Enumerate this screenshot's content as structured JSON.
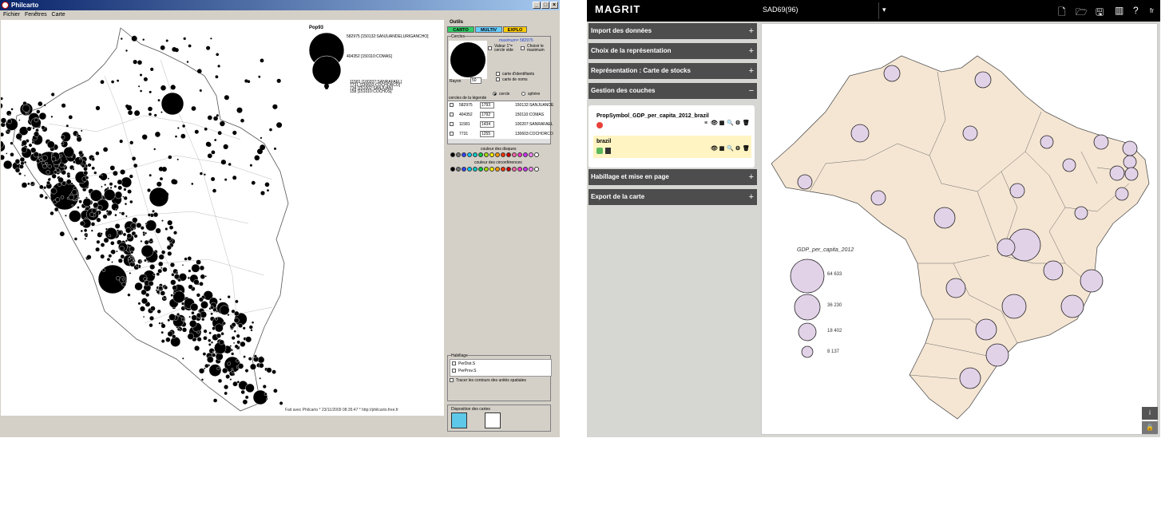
{
  "philcarto": {
    "title": "Philcarto",
    "menu": [
      "Fichier",
      "Fenêtres",
      "Carte"
    ],
    "window_buttons": [
      "_",
      "□",
      "×"
    ],
    "legend": {
      "title": "Pop93",
      "items": [
        {
          "value": "582975",
          "id": "[150132:SANJUANDELURIGANCHO]"
        },
        {
          "value": "404352",
          "id": "[150110:COMAS]"
        },
        {
          "value": "11581",
          "id": "[100207:SANRAFAEL]"
        },
        {
          "value": "7731",
          "id": "[130603:COCHORCO]"
        },
        {
          "value": "734",
          "id": "[151002:SANJUAN]"
        },
        {
          "value": "158",
          "id": "[151010:COCHOS]"
        }
      ]
    },
    "credit": "Fait avec Philcarto * 23/11/2009 08:35:47 * http://philcarto.free.fr",
    "tools": {
      "title": "Outils",
      "tabs": [
        {
          "label": "CARTO",
          "color": "#33cc66"
        },
        {
          "label": "MULTIV",
          "color": "#66ccff"
        },
        {
          "label": "EXPLO",
          "color": "#ffcc00"
        }
      ],
      "circles_group": "Cercles",
      "maximum": "maximum= 582975",
      "valeur_label": "Valeur 1\"= cercle vide",
      "choisir_label": "Choisir le maximum",
      "rayon_label": "Rayon",
      "rayon_value": "50",
      "carte_identifiants": "carte d'identifiants",
      "carte_noms": "carte de noms",
      "shape_options": [
        "cercle",
        "sphère"
      ],
      "legend_circles_title": "cercles de la légende",
      "legend_rows": [
        {
          "value": "582975",
          "pos": "1793",
          "name": "150132:SANJUANDE"
        },
        {
          "value": "404352",
          "pos": "1792",
          "name": "150110:COMAS"
        },
        {
          "value": "11581",
          "pos": "1434",
          "name": "100207:SANRAFAEL"
        },
        {
          "value": "7731",
          "pos": "1255",
          "name": "130603:COCHORCO"
        }
      ],
      "disc_color_label": "couleur des disques",
      "circ_color_label": "couleur des circonférences",
      "swatches": [
        "#000000",
        "#777777",
        "#3344ff",
        "#00ccff",
        "#00cccc",
        "#00cc44",
        "#aadd00",
        "#ffee00",
        "#ff9900",
        "#ff3300",
        "#cc0000",
        "#ff66aa",
        "#ff33cc",
        "#cc33ff",
        "#ff88ff",
        "#ffffff"
      ],
      "habillage_title": "Habillage",
      "habillage_items": [
        "PerDist.S",
        "PerProv.S"
      ],
      "trace_label": "Tracer les contours des unités spatiales",
      "disposition_title": "Disposition des cartes"
    }
  },
  "magrit": {
    "logo": "MAGRIT",
    "project": "SAD69(96)",
    "lang": "fr",
    "sections": [
      {
        "label": "Import des données",
        "sign": "+"
      },
      {
        "label": "Choix de la représentation",
        "sign": "+"
      },
      {
        "label": "Représentation : Carte de stocks",
        "sign": "+"
      },
      {
        "label": "Gestion des couches",
        "sign": "−"
      },
      {
        "label": "Habillage et mise en page",
        "sign": "+"
      },
      {
        "label": "Export de la carte",
        "sign": "+"
      }
    ],
    "layers": [
      {
        "name": "PropSymbol_GDP_per_capita_2012_brazil"
      },
      {
        "name": "brazil"
      }
    ],
    "map_legend": {
      "title": "GDP_per_capita_2012",
      "items": [
        "64 633",
        "36 230",
        "18 402",
        "8 137"
      ]
    },
    "side_buttons": [
      "i",
      "🔒"
    ],
    "colors": {
      "land": "#f5e6d3",
      "circle": "#e2d2e8",
      "header": "#000000",
      "section": "#4d4d4d",
      "highlight": "#fff4c2"
    }
  }
}
